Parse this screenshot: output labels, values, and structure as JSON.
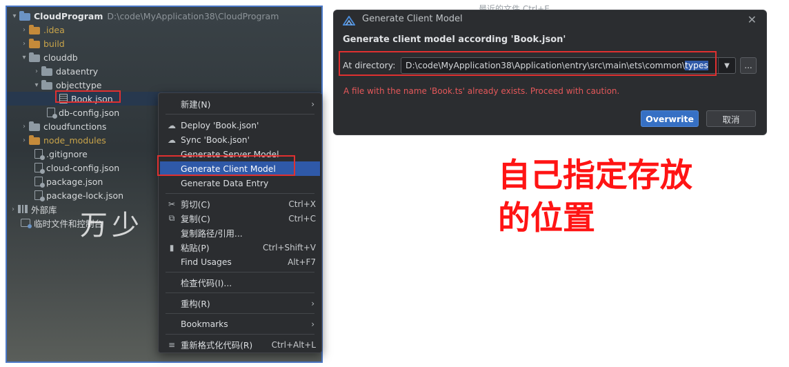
{
  "project_tree": {
    "root": {
      "name": "CloudProgram",
      "path": "D:\\code\\MyApplication38\\CloudProgram"
    },
    "items": [
      {
        "label": ".idea"
      },
      {
        "label": "build"
      },
      {
        "label": "clouddb"
      },
      {
        "label": "dataentry"
      },
      {
        "label": "objecttype"
      },
      {
        "label": "Book.json"
      },
      {
        "label": "db-config.json"
      },
      {
        "label": "cloudfunctions"
      },
      {
        "label": "node_modules"
      },
      {
        "label": ".gitignore"
      },
      {
        "label": "cloud-config.json"
      },
      {
        "label": "package.json"
      },
      {
        "label": "package-lock.json"
      },
      {
        "label": "外部库"
      },
      {
        "label": "临时文件和控制台"
      }
    ],
    "background_text": "万少"
  },
  "context_menu": {
    "items": [
      {
        "label": "新建(N)"
      },
      {
        "label": "Deploy 'Book.json'"
      },
      {
        "label": "Sync 'Book.json'"
      },
      {
        "label": "Generate Server Model"
      },
      {
        "label": "Generate Client Model"
      },
      {
        "label": "Generate Data Entry"
      },
      {
        "label": "剪切(C)",
        "shortcut": "Ctrl+X"
      },
      {
        "label": "复制(C)",
        "shortcut": "Ctrl+C"
      },
      {
        "label": "复制路径/引用..."
      },
      {
        "label": "粘贴(P)",
        "shortcut": "Ctrl+Shift+V"
      },
      {
        "label": "Find Usages",
        "shortcut": "Alt+F7"
      },
      {
        "label": "检查代码(I)..."
      },
      {
        "label": "重构(R)"
      },
      {
        "label": "Bookmarks"
      },
      {
        "label": "重新格式化代码(R)",
        "shortcut": "Ctrl+Alt+L"
      }
    ]
  },
  "dialog": {
    "title": "Generate Client Model",
    "heading": "Generate client model according 'Book.json'",
    "directory_label": "At directory:",
    "directory_prefix": "D:\\code\\MyApplication38\\Application\\entry\\src\\main\\ets\\common\\",
    "directory_selected": "types",
    "browse_label": "...",
    "warning": "A file with the name 'Book.ts' already exists. Proceed with caution.",
    "primary_button": "Overwrite",
    "cancel_button": "取消"
  },
  "background_hint": "最近的文件  Ctrl+E",
  "annotation": {
    "line1": "自己指定存放",
    "line2": "的位置"
  },
  "colors": {
    "annotation": "#ff1414",
    "highlight": "#2f59a8",
    "warning": "#e5585a",
    "primary_button": "#3670c4"
  }
}
